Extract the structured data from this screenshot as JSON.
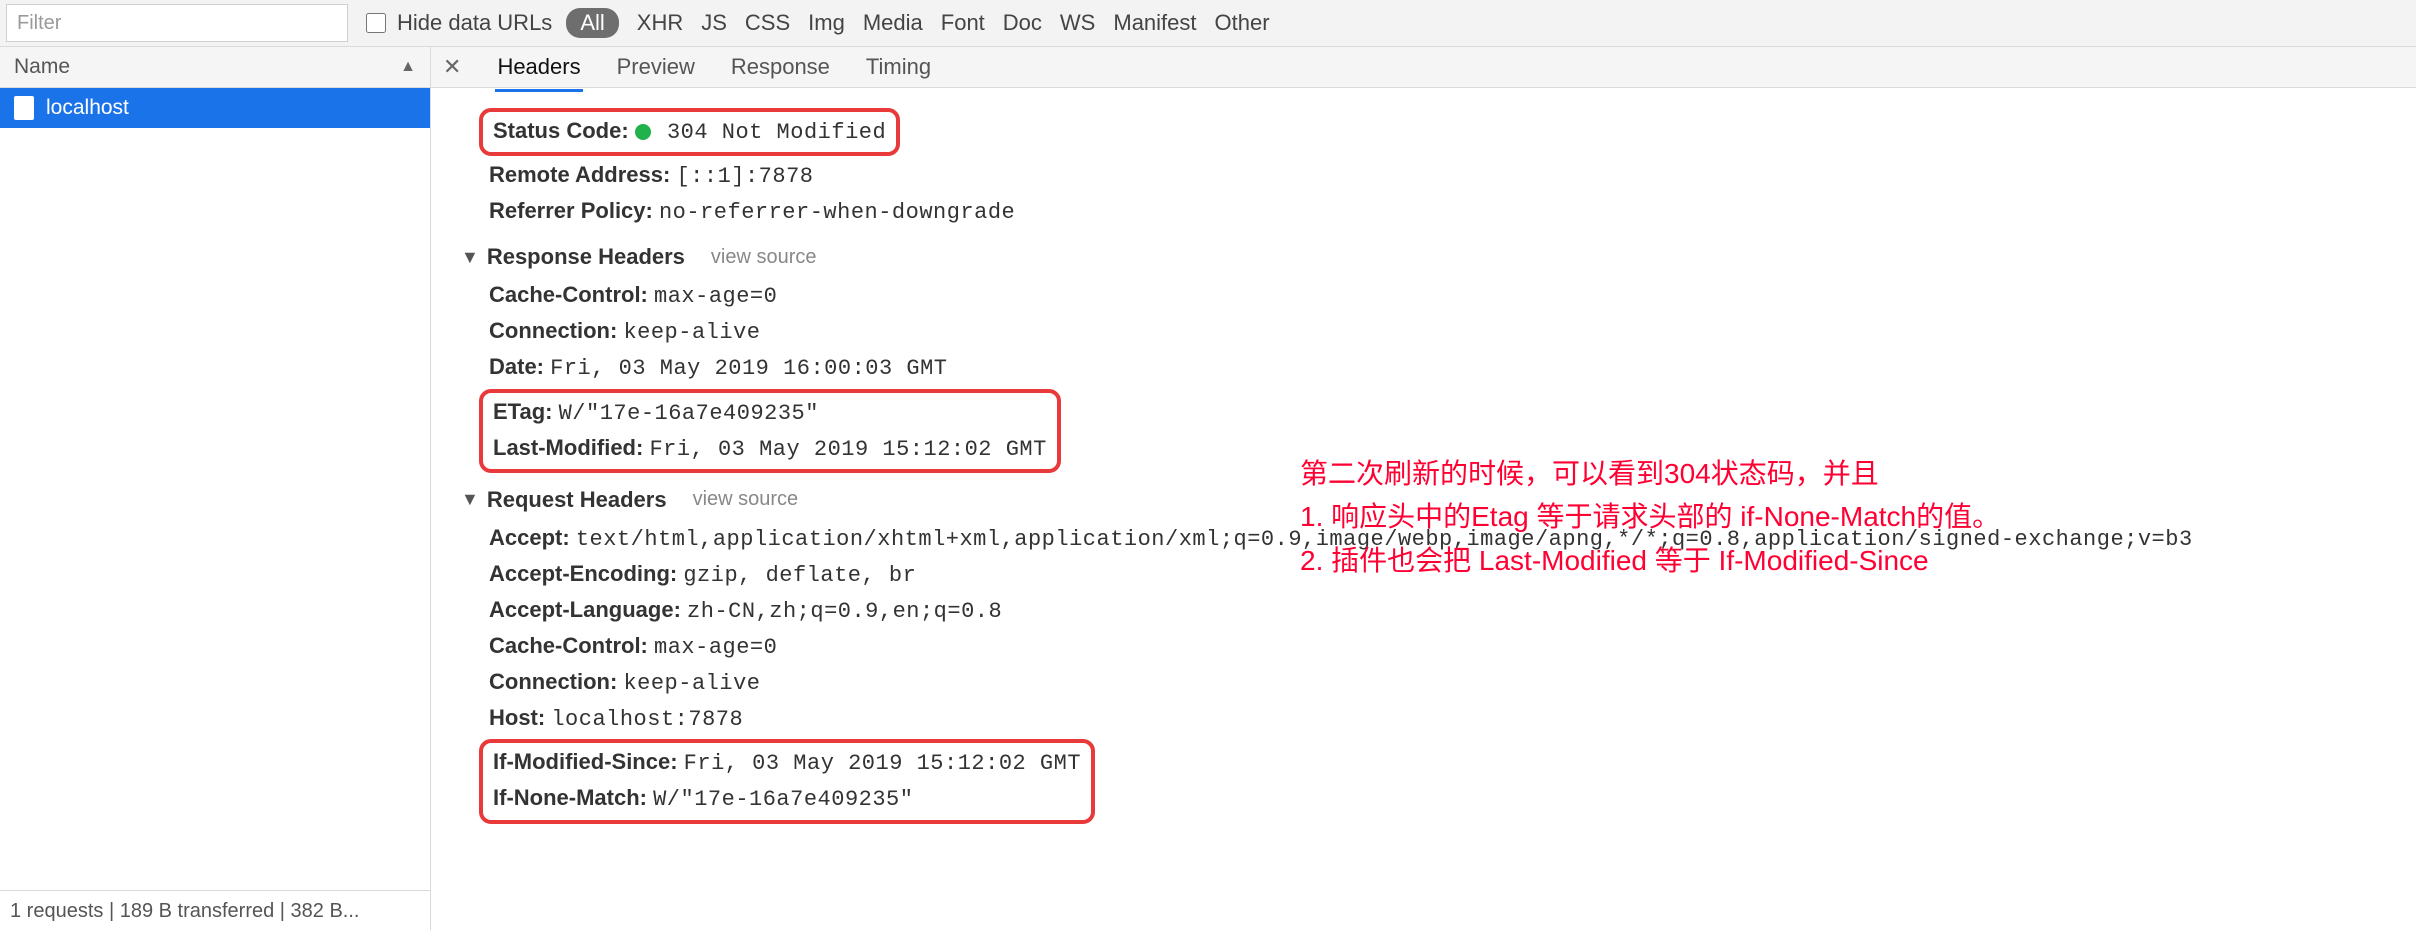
{
  "toolbar": {
    "filter_placeholder": "Filter",
    "hide_data_urls_label": "Hide data URLs",
    "types": [
      "All",
      "XHR",
      "JS",
      "CSS",
      "Img",
      "Media",
      "Font",
      "Doc",
      "WS",
      "Manifest",
      "Other"
    ]
  },
  "sidebar": {
    "column_name": "Name",
    "items": [
      {
        "name": "localhost"
      }
    ],
    "status_bar": "1 requests | 189 B transferred | 382 B..."
  },
  "detail": {
    "tabs": [
      "Headers",
      "Preview",
      "Response",
      "Timing"
    ],
    "selected_tab": "Headers",
    "general": {
      "status_code_label": "Status Code:",
      "status_code_value": "304 Not Modified",
      "remote_address_label": "Remote Address:",
      "remote_address_value": "[::1]:7878",
      "referrer_policy_label": "Referrer Policy:",
      "referrer_policy_value": "no-referrer-when-downgrade"
    },
    "response_headers": {
      "title": "Response Headers",
      "view_source": "view source",
      "lines": [
        {
          "k": "Cache-Control:",
          "v": "max-age=0"
        },
        {
          "k": "Connection:",
          "v": "keep-alive"
        },
        {
          "k": "Date:",
          "v": "Fri, 03 May 2019 16:00:03 GMT"
        },
        {
          "k": "ETag:",
          "v": "W/\"17e-16a7e409235\""
        },
        {
          "k": "Last-Modified:",
          "v": "Fri, 03 May 2019 15:12:02 GMT"
        }
      ]
    },
    "request_headers": {
      "title": "Request Headers",
      "view_source": "view source",
      "lines": [
        {
          "k": "Accept:",
          "v": "text/html,application/xhtml+xml,application/xml;q=0.9,image/webp,image/apng,*/*;q=0.8,application/signed-exchange;v=b3"
        },
        {
          "k": "Accept-Encoding:",
          "v": "gzip, deflate, br"
        },
        {
          "k": "Accept-Language:",
          "v": "zh-CN,zh;q=0.9,en;q=0.8"
        },
        {
          "k": "Cache-Control:",
          "v": "max-age=0"
        },
        {
          "k": "Connection:",
          "v": "keep-alive"
        },
        {
          "k": "Host:",
          "v": "localhost:7878"
        },
        {
          "k": "If-Modified-Since:",
          "v": "Fri, 03 May 2019 15:12:02 GMT"
        },
        {
          "k": "If-None-Match:",
          "v": "W/\"17e-16a7e409235\""
        }
      ]
    }
  },
  "annotation": {
    "line1": "第二次刷新的时候，可以看到304状态码，并且",
    "line2": "1. 响应头中的Etag 等于请求头部的 if-None-Match的值。",
    "line3": "2. 插件也会把 Last-Modified 等于 If-Modified-Since"
  }
}
